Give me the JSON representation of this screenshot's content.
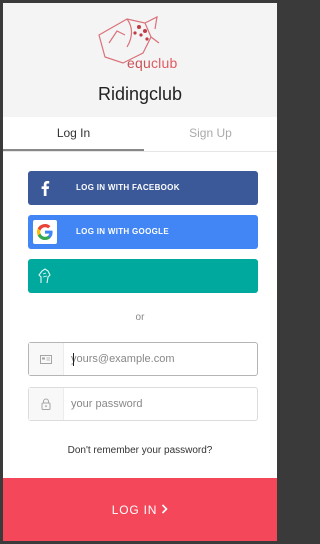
{
  "brand": {
    "logo_icon": "horse-head-icon",
    "logo_text_prefix": "equ",
    "logo_text_suffix": "club",
    "title": "Ridingclub"
  },
  "tabs": [
    {
      "label": "Log In",
      "active": true
    },
    {
      "label": "Sign Up",
      "active": false
    }
  ],
  "social": {
    "facebook_label": "LOG IN WITH FACEBOOK",
    "google_label": "LOG IN WITH GOOGLE",
    "equestrian_label": ""
  },
  "divider_text": "or",
  "form": {
    "email_placeholder": "yours@example.com",
    "password_placeholder": "your password",
    "forgot_text": "Don't remember your password?",
    "submit_label": "LOG IN"
  },
  "colors": {
    "facebook": "#3b5998",
    "google": "#4285f4",
    "equestrian": "#00a99d",
    "submit": "#f5475a"
  }
}
